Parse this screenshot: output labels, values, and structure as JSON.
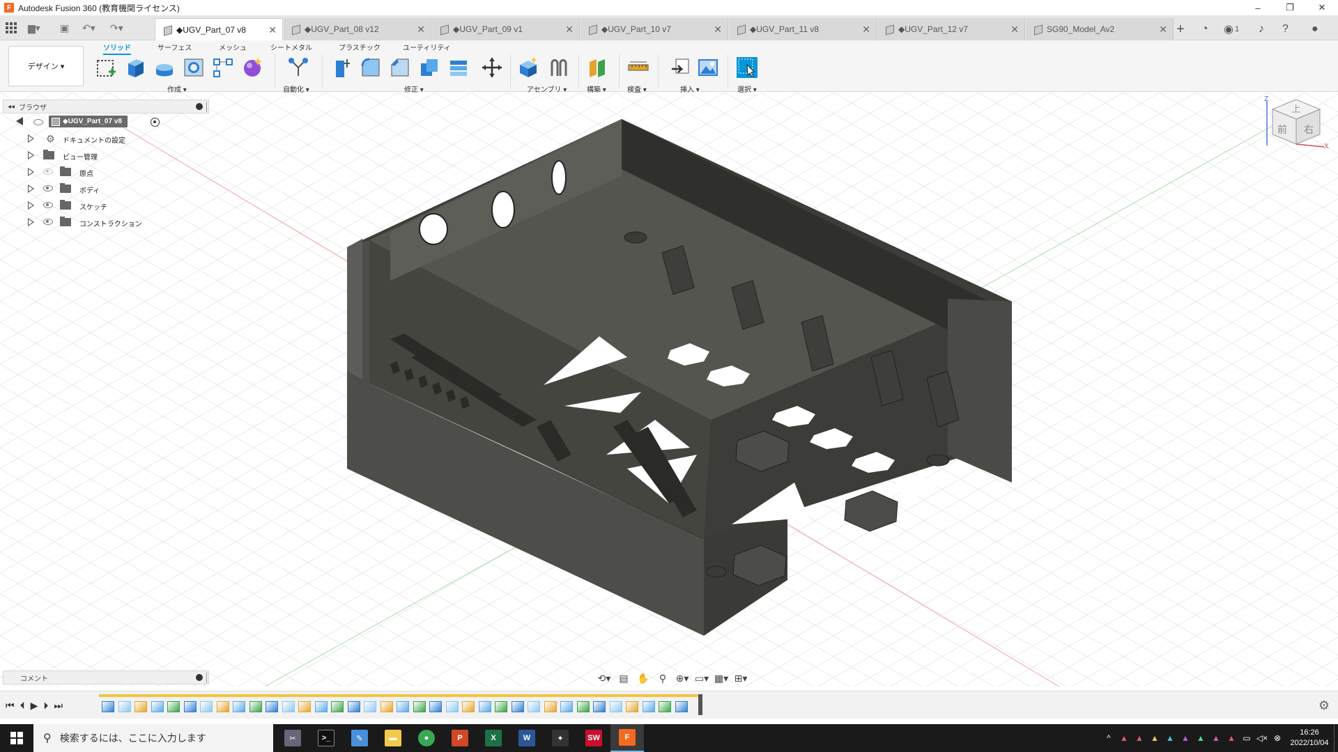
{
  "window": {
    "title": "Autodesk Fusion 360 (教育機関ライセンス)",
    "minimize": "–",
    "restore": "❐",
    "close": "✕"
  },
  "tabs": [
    {
      "label": "◆UGV_Part_07 v8",
      "active": true
    },
    {
      "label": "◆UGV_Part_08 v12",
      "active": false
    },
    {
      "label": "◆UGV_Part_09 v1",
      "active": false
    },
    {
      "label": "◆UGV_Part_10 v7",
      "active": false
    },
    {
      "label": "◆UGV_Part_11 v8",
      "active": false
    },
    {
      "label": "◆UGV_Part_12 v7",
      "active": false
    },
    {
      "label": "SG90_Model_Av2",
      "active": false
    }
  ],
  "tab_right": {
    "add": "+",
    "job_count": "1"
  },
  "toolbar": {
    "workspace": "デザイン ▾",
    "tabs": [
      "ソリッド",
      "サーフェス",
      "メッシュ",
      "シートメタル",
      "プラスチック",
      "ユーティリティ"
    ],
    "groups": {
      "create": "作成 ▾",
      "automate": "自動化 ▾",
      "modify": "修正 ▾",
      "assemble": "アセンブリ ▾",
      "construct": "構築 ▾",
      "inspect": "検査 ▾",
      "insert": "挿入 ▾",
      "select": "選択 ▾"
    }
  },
  "browser": {
    "title": "ブラウザ",
    "root": "◆UGV_Part_07 v8",
    "items": [
      {
        "label": "ドキュメントの設定",
        "icon": "gear-icon"
      },
      {
        "label": "ビュー管理",
        "icon": "folder-icon"
      },
      {
        "label": "原点",
        "icon": "folder-icon"
      },
      {
        "label": "ボディ",
        "icon": "folder-icon"
      },
      {
        "label": "スケッチ",
        "icon": "folder-icon"
      },
      {
        "label": "コンストラクション",
        "icon": "folder-icon"
      }
    ]
  },
  "comments": {
    "title": "コメント"
  },
  "viewcube": {
    "top": "上",
    "front": "前",
    "right": "右",
    "axis_z": "Z",
    "axis_x": "X"
  },
  "taskbar": {
    "search_placeholder": "検索するには、ここに入力します",
    "time": "16:26",
    "date": "2022/10/04"
  },
  "colors": {
    "accent": "#0696d7",
    "model": "#4a4a46",
    "timeline_bar": "#f4c542",
    "fusion_orange": "#f26a22"
  }
}
